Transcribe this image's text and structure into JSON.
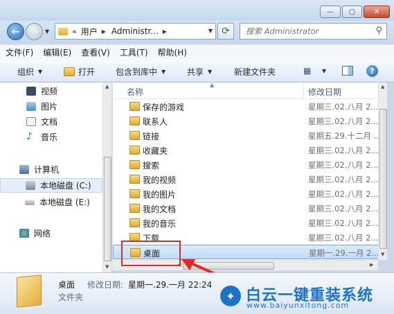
{
  "titlebar": {
    "minimize_label": "—",
    "maximize_label": "▢",
    "close_label": "✕"
  },
  "address": {
    "chevron": "«",
    "segments": [
      "用户",
      "Administr..."
    ],
    "search_placeholder": "搜索 Administrator"
  },
  "menu": [
    "文件(F)",
    "编辑(E)",
    "查看(V)",
    "工具(T)",
    "帮助(H)"
  ],
  "toolbar": {
    "organize": "组织",
    "open": "打开",
    "include": "包含到库中",
    "share": "共享",
    "new_folder": "新建文件夹"
  },
  "nav": {
    "videos": "视频",
    "pictures": "图片",
    "documents": "文档",
    "music": "音乐",
    "computer": "计算机",
    "drive_c": "本地磁盘 (C:)",
    "drive_e": "本地磁盘 (E:)",
    "network": "网络"
  },
  "columns": {
    "name": "名称",
    "date": "修改日期"
  },
  "files": [
    {
      "name": "保存的游戏",
      "date": "星期三.02.八月 2..."
    },
    {
      "name": "联系人",
      "date": "星期三.02.八月 2..."
    },
    {
      "name": "链接",
      "date": "星期五.29.十二月 ..."
    },
    {
      "name": "收藏夹",
      "date": "星期三.02.八月 2..."
    },
    {
      "name": "搜索",
      "date": "星期三.02.八月 2..."
    },
    {
      "name": "我的视频",
      "date": "星期三.02.八月 2..."
    },
    {
      "name": "我的图片",
      "date": "星期三.02.八月 2..."
    },
    {
      "name": "我的文档",
      "date": "星期三.02.八月 2..."
    },
    {
      "name": "我的音乐",
      "date": "星期三.02.八月 2..."
    },
    {
      "name": "下载",
      "date": "星期三.02.八月 2..."
    },
    {
      "name": "桌面",
      "date": "星期一.29.一月 2..."
    }
  ],
  "details": {
    "name": "桌面",
    "modified_label": "修改日期:",
    "modified_value": "星期一.29.一月 22:24",
    "type": "文件夹"
  },
  "watermark": {
    "title": "白云一键重装系统",
    "url": "www.baiyunxitong.com"
  },
  "colors": {
    "highlight": "#e02a2a",
    "brand": "#1e73c8"
  }
}
